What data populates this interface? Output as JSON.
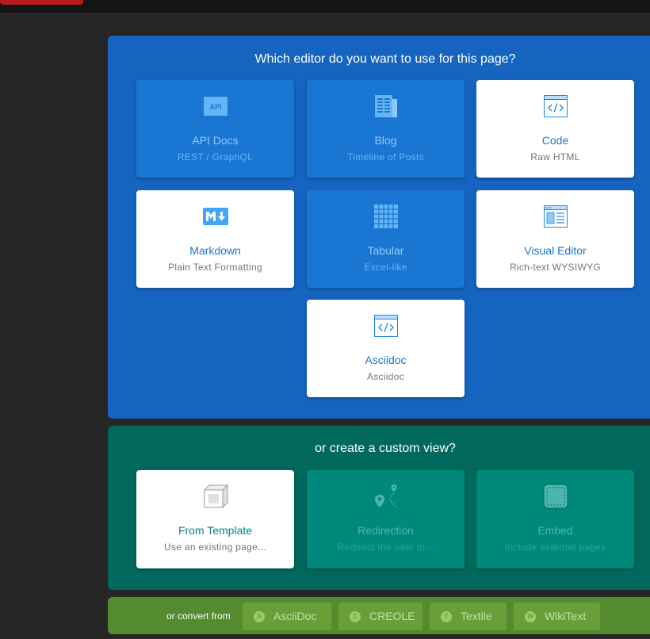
{
  "editor_prompt": "Which editor do you want to use for this page?",
  "editors": [
    {
      "title": "API Docs",
      "sub": "REST / GraphQL",
      "icon": "api-icon",
      "enabled": false
    },
    {
      "title": "Blog",
      "sub": "Timeline of Posts",
      "icon": "blog-icon",
      "enabled": false
    },
    {
      "title": "Code",
      "sub": "Raw HTML",
      "icon": "code-icon",
      "enabled": true
    },
    {
      "title": "Markdown",
      "sub": "Plain Text Formatting",
      "icon": "markdown-icon",
      "enabled": true
    },
    {
      "title": "Tabular",
      "sub": "Excel-like",
      "icon": "table-icon",
      "enabled": false
    },
    {
      "title": "Visual Editor",
      "sub": "Rich-text WYSIWYG",
      "icon": "visual-editor-icon",
      "enabled": true
    },
    {
      "title": "Asciidoc",
      "sub": "Asciidoc",
      "icon": "code-icon",
      "enabled": true
    }
  ],
  "custom_prompt": "or create a custom view?",
  "custom_views": [
    {
      "title": "From Template",
      "sub": "Use an existing page...",
      "icon": "template-icon",
      "enabled": true
    },
    {
      "title": "Redirection",
      "sub": "Redirect the user to...",
      "icon": "route-icon",
      "enabled": false
    },
    {
      "title": "Embed",
      "sub": "Include external pages",
      "icon": "embed-icon",
      "enabled": false
    }
  ],
  "convert": {
    "label": "or convert from",
    "options": [
      {
        "letter": "A",
        "label": "AsciiDoc"
      },
      {
        "letter": "C",
        "label": "CREOLE"
      },
      {
        "letter": "T",
        "label": "Textile"
      },
      {
        "letter": "W",
        "label": "WikiText"
      }
    ]
  },
  "colors": {
    "editor_panel": "#1565c0",
    "custom_panel": "#00695c",
    "convert_panel": "#558b2f",
    "accent_blue": "#1976d2",
    "accent_teal": "#00897b"
  }
}
